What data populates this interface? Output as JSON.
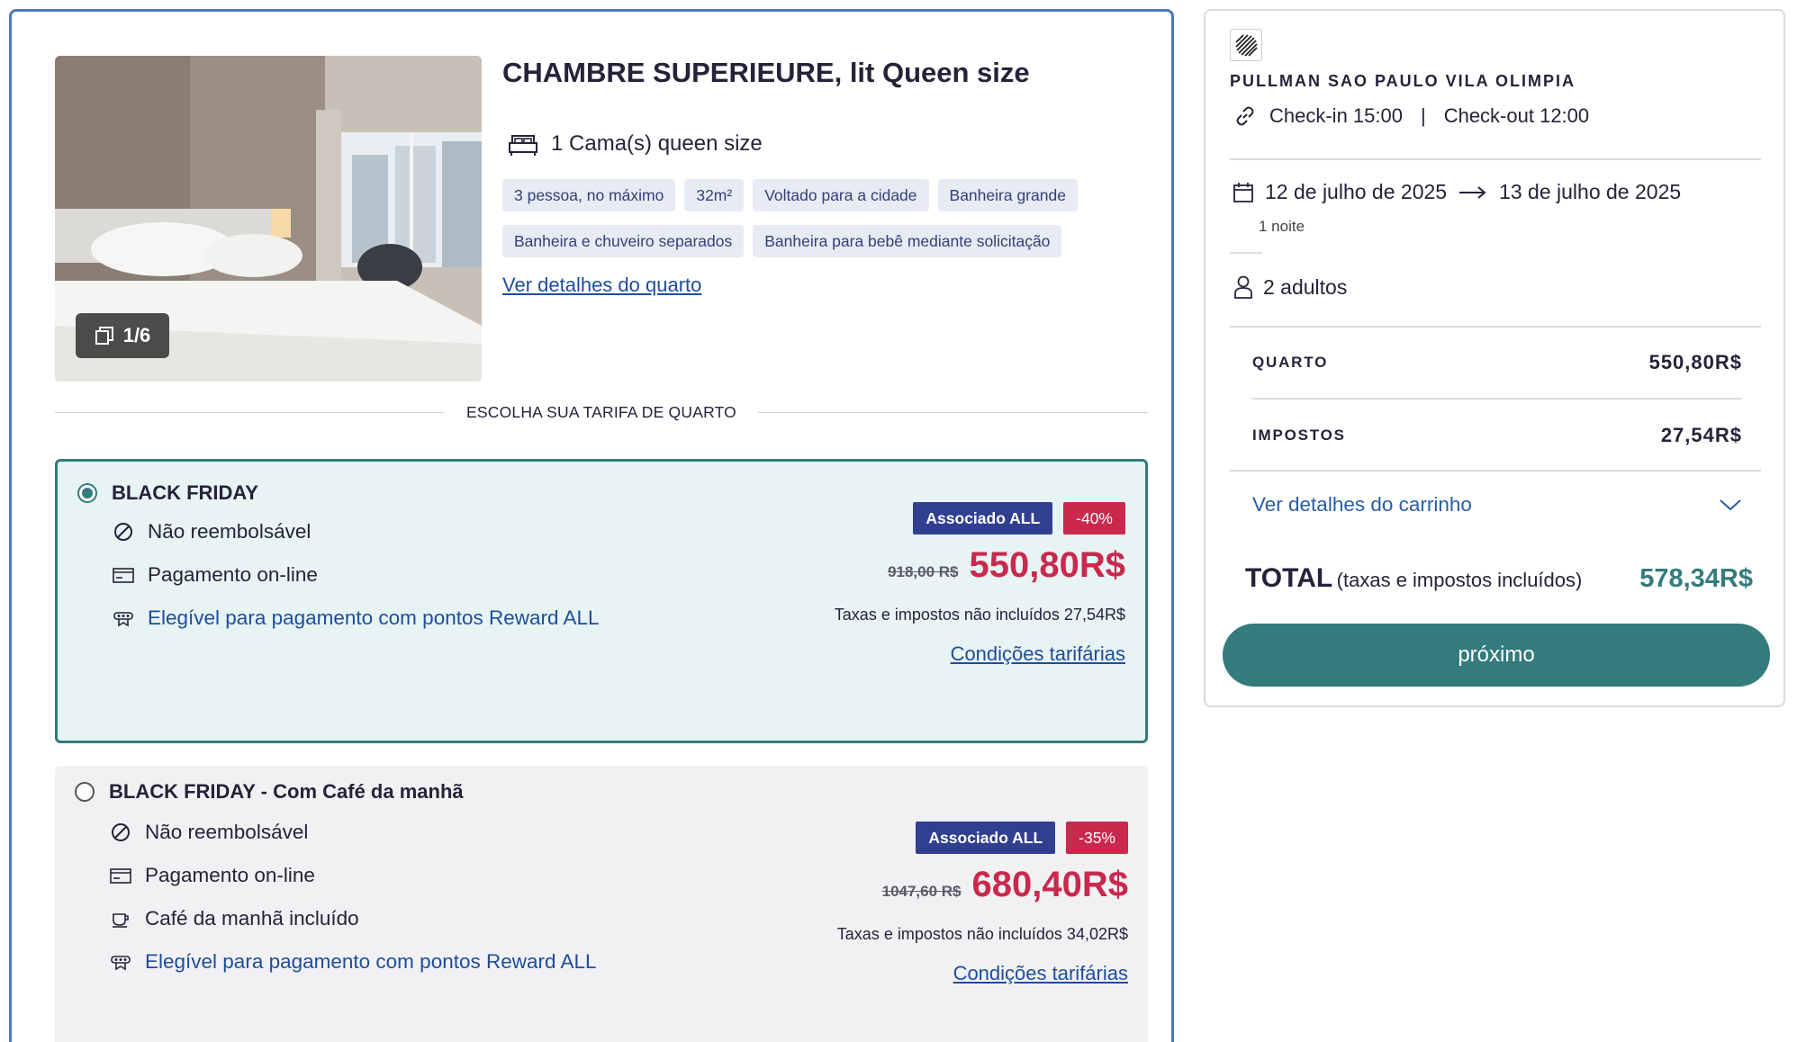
{
  "room": {
    "title": "CHAMBRE SUPERIEURE, lit Queen size",
    "photo_counter": "1/6",
    "bed": "1 Cama(s) queen size",
    "features_row1": [
      "3 pessoa, no máximo",
      "32m²",
      "Voltado para a cidade",
      "Banheira grande"
    ],
    "features_row2": [
      "Banheira e chuveiro separados",
      "Banheira para bebê mediante solicitação"
    ],
    "details_link": "Ver detalhes do quarto",
    "choose_rate_label": "ESCOLHA SUA TARIFA DE QUARTO"
  },
  "rates": [
    {
      "name": "BLACK FRIDAY",
      "selected": true,
      "features": [
        "Não reembolsável",
        "Pagamento on-line",
        "Elegível para pagamento com pontos Reward ALL"
      ],
      "member_badge": "Associado ALL",
      "discount_badge": "-40%",
      "old_price": "918,00 R$",
      "price": "550,80R$",
      "tax_note": "Taxas e impostos não incluídos 27,54R$",
      "conditions_link": "Condições tarifárias"
    },
    {
      "name": "BLACK FRIDAY - Com Café da manhã",
      "selected": false,
      "features": [
        "Não reembolsável",
        "Pagamento on-line",
        "Café da manhã incluído",
        "Elegível para pagamento com pontos Reward ALL"
      ],
      "member_badge": "Associado ALL",
      "discount_badge": "-35%",
      "old_price": "1047,60 R$",
      "price": "680,40R$",
      "tax_note": "Taxas e impostos não incluídos 34,02R$",
      "conditions_link": "Condições tarifárias"
    }
  ],
  "summary": {
    "hotel_name": "PULLMAN SAO PAULO VILA OLIMPIA",
    "checkin": "Check-in 15:00",
    "separator": "|",
    "checkout": "Check-out 12:00",
    "date_from": "12 de julho de 2025",
    "date_to": "13 de julho de 2025",
    "nights": "1 noite",
    "guests": "2 adultos",
    "room_label": "QUARTO",
    "room_value": "550,80R$",
    "taxes_label": "IMPOSTOS",
    "taxes_value": "27,54R$",
    "cart_link": "Ver detalhes do carrinho",
    "total_label": "TOTAL",
    "total_sub": "(taxas e impostos incluídos)",
    "total_value": "578,34R$",
    "next_button": "próximo"
  },
  "colors": {
    "accent_teal": "#347b7d",
    "price_red": "#c9294d",
    "member_blue": "#303f8f",
    "link_blue": "#1c4e9c"
  }
}
